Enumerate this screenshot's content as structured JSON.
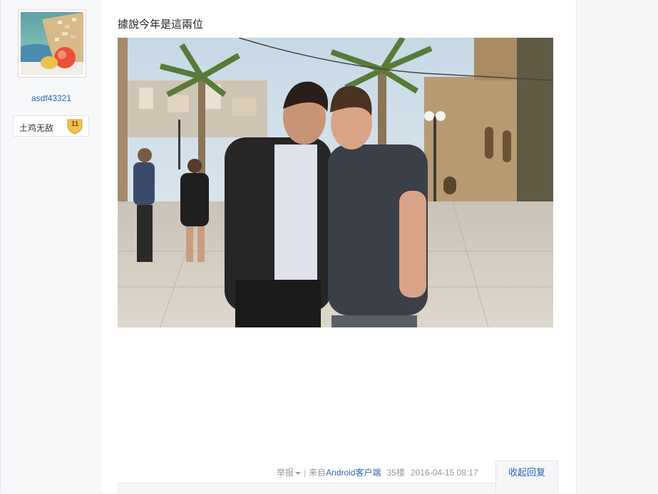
{
  "author": {
    "username": "asdf43321",
    "level_name": "土鸡无敌",
    "level_number": "11"
  },
  "post": {
    "text": "據說今年是這兩位"
  },
  "tail": {
    "report_label": "举报",
    "separator": "|",
    "source_prefix": "来自",
    "source_client": "Android客户端",
    "floor": "35楼",
    "timestamp": "2016-04-15 08:17",
    "collapse_label": "收起回复"
  },
  "colors": {
    "link_blue": "#2d64b3",
    "level_gold": "#f2c14e"
  }
}
